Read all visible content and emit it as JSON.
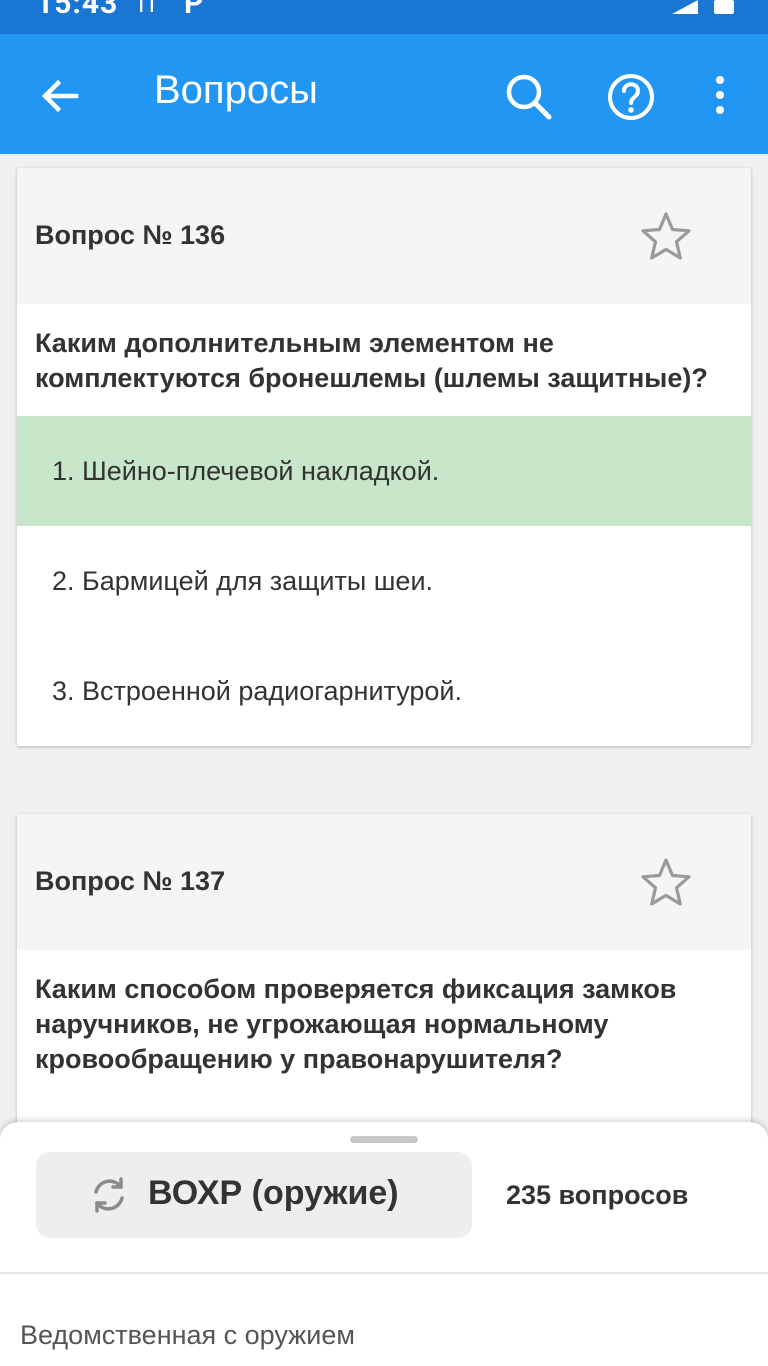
{
  "status_bar": {
    "time": "15:43",
    "extra": "П",
    "app_letter": "P",
    "icons": [
      "signal-icon",
      "battery-icon"
    ]
  },
  "app_bar": {
    "title": "Вопросы",
    "icons": [
      "back-arrow-icon",
      "search-icon",
      "help-icon",
      "more-vert-icon"
    ],
    "color": "#2196f3"
  },
  "questions": [
    {
      "number_label": "Вопрос № 136",
      "text": "Каким дополнительным элементом не комплектуются бронешлемы (шлемы защитные)?",
      "answers": [
        {
          "label": "1. Шейно-плечевой накладкой.",
          "correct": true
        },
        {
          "label": "2. Бармицей для защиты шеи.",
          "correct": false
        },
        {
          "label": "3. Встроенной радиогарнитурой.",
          "correct": false
        }
      ]
    },
    {
      "number_label": "Вопрос № 137",
      "text": "Каким способом проверяется фиксация замков наручников, не угрожающая нормальному кровообращению у правонарушителя?",
      "answers": []
    }
  ],
  "bottom_sheet": {
    "topic_label": "ВОХР (оружие)",
    "count_label": "235 вопросов",
    "category": "Ведомственная с оружием"
  },
  "colors": {
    "correct_answer_bg": "#c8e6c9",
    "card_header_bg": "#f5f5f5"
  }
}
